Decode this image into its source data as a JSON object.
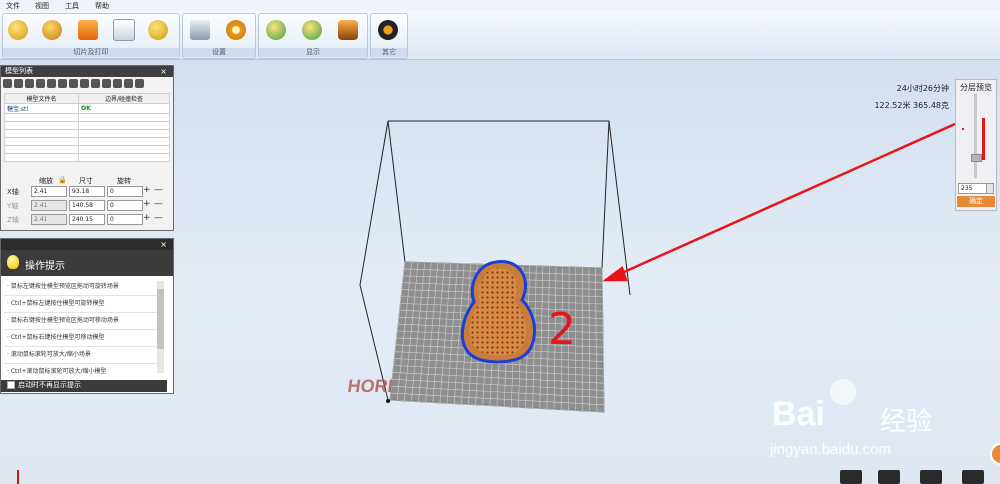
{
  "menu": [
    "文件",
    "视图",
    "工具",
    "帮助"
  ],
  "ribbon": {
    "groups": [
      {
        "name": "切片及打印",
        "buttons": [
          "load-model-icon",
          "database-icon",
          "exit-icon",
          "print-doc-icon",
          "figure-icon"
        ]
      },
      {
        "name": "设置",
        "buttons": [
          "printer-icon",
          "settings-gear-icon"
        ]
      },
      {
        "name": "显示",
        "buttons": [
          "show-model-icon",
          "model-list-icon",
          "trophy-icon"
        ]
      },
      {
        "name": "其它",
        "buttons": [
          "other-icon"
        ]
      }
    ]
  },
  "model_panel": {
    "title": "模型列表",
    "close": "×",
    "table": {
      "headers": [
        "模型文件名",
        "边界/碰撞检查"
      ],
      "rows": [
        [
          "糖宝.stl",
          "OK"
        ]
      ]
    },
    "transform": {
      "headers": [
        "缩放",
        "尺寸",
        "旋转"
      ],
      "axes": [
        {
          "label": "X轴",
          "scale": "2.41",
          "size": "93.18",
          "rotate": "0"
        },
        {
          "label": "Y轴",
          "scale": "2.41",
          "size": "140.58",
          "rotate": "0"
        },
        {
          "label": "Z轴",
          "scale": "2.41",
          "size": "240.15",
          "rotate": "0"
        }
      ],
      "plus": "+",
      "minus": "—"
    }
  },
  "help_panel": {
    "title": "操作提示",
    "close": "×",
    "tips": [
      "· 鼠标左键按住模型预览区拖动可旋转场景",
      "· Ctrl+鼠标左键按住模型可旋转模型",
      "· 鼠标右键按住模型预览区拖动可移动场景",
      "· Ctrl+鼠标右键按住模型可移动模型",
      "· 滚动鼠标滚轮可放大/缩小场景",
      "· Ctrl+滚动鼠标滚轮可放大/缩小模型"
    ],
    "checkbox_label": "启动时不再显示提示"
  },
  "print_info": {
    "time": "24小时26分钟",
    "size_weight": "122.52米  365.48克"
  },
  "layer_preview": {
    "title": "分层预览",
    "layer_value": "235",
    "confirm": "确定"
  },
  "scene": {
    "plate_brand": "HORI",
    "annotation": "2"
  },
  "watermark": {
    "brand": "Bai",
    "brand2": "经验",
    "url": "jingyan.baidu.com"
  },
  "colors": {
    "accent_orange": "#e8893a",
    "model_fill": "#c87a3a",
    "model_edge": "#1a3fd6",
    "annotation_red": "#e8141a"
  }
}
